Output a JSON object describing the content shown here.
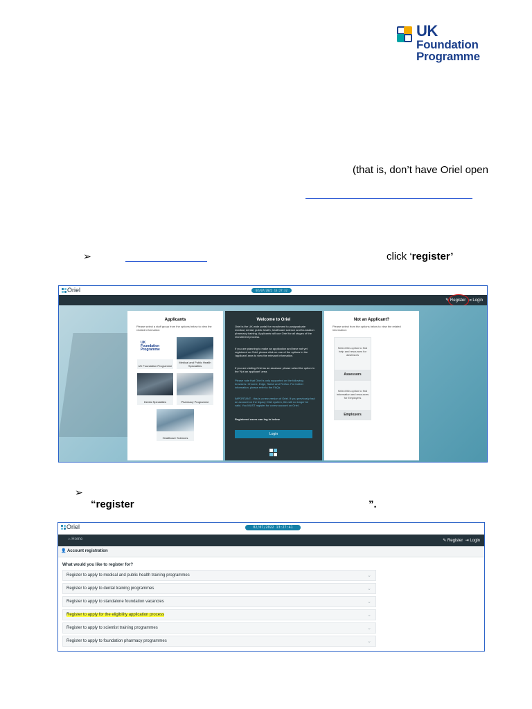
{
  "logo": {
    "line1": "UK",
    "line2": "Foundation",
    "line3": "Programme",
    "colors": [
      "#1b3f8b",
      "#f2a900",
      "#00a3a6",
      "#1b3f8b"
    ]
  },
  "doc": {
    "paren_text": "(that is, don’t have Oriel open",
    "bullet_glyph": "➢",
    "click_text": "click ‘",
    "click_bold": "register",
    "click_end": "’",
    "register_quote_open": "“register",
    "quote_close": "”."
  },
  "oriel1": {
    "brand": "Oriel",
    "clock": "02/07/2022 13:27:32",
    "nav_register": "Register",
    "nav_login": "Login",
    "applicants": {
      "title": "Applicants",
      "subtitle": "Please select a staff group from the options below to view the related information:",
      "tiles": [
        {
          "label": "UK Foundation Programme"
        },
        {
          "label": "Medical and Public Health Specialties"
        },
        {
          "label": "Dental Specialties"
        },
        {
          "label": "Pharmacy Programme"
        },
        {
          "label": "Healthcare Sciences"
        }
      ]
    },
    "welcome": {
      "title": "Welcome to Oriel",
      "p1": "Oriel is the UK wide portal for recruitment to postgraduate medical, dental, public health, healthcare science and foundation pharmacy training. Applicants will use Oriel for all stages of the recruitment process.",
      "p2": "If you are planning to make an application and have not yet registered on Oriel, please click on one of the options in the 'applicant' area to view the relevant information.",
      "p3": "If you are visiting Oriel as an assessor please select the option in the 'Not an applicant' area.",
      "p4": "Please note that Oriel is only supported on the following browsers: Chrome, Edge, Safari and Firefox. For further information, please refer to the FAQs.",
      "p5": "IMPORTANT - this is a new version of Oriel. If you previously had an account on the legacy Oriel system, this will no longer be valid. You MUST register for a new account on Oriel.",
      "registered": "Registered users can log in below",
      "login_btn": "Login"
    },
    "not_applicant": {
      "title": "Not an Applicant?",
      "subtitle": "Please select from the options below to view the related information:",
      "boxes": [
        {
          "text": "Select this option to find help and resources for assessors",
          "button": "Assessors"
        },
        {
          "text": "Select this option to find information and resources for Employers",
          "button": "Employers"
        }
      ]
    }
  },
  "oriel2": {
    "brand": "Oriel",
    "clock": "02/07/2022 13:27:41",
    "home": "Home",
    "nav_register": "Register",
    "nav_login": "Login",
    "section_title": "Account registration",
    "question": "What would you like to register for?",
    "options": [
      {
        "label": "Register to apply to medical and public health training programmes",
        "highlight": false
      },
      {
        "label": "Register to apply to dental training programmes",
        "highlight": false
      },
      {
        "label": "Register to apply to standalone foundation vacancies",
        "highlight": false
      },
      {
        "label": "Register to apply for the eligibility application process",
        "highlight": true
      },
      {
        "label": "Register to apply to scientist training programmes",
        "highlight": false
      },
      {
        "label": "Register to apply to foundation pharmacy programmes",
        "highlight": false
      }
    ]
  }
}
